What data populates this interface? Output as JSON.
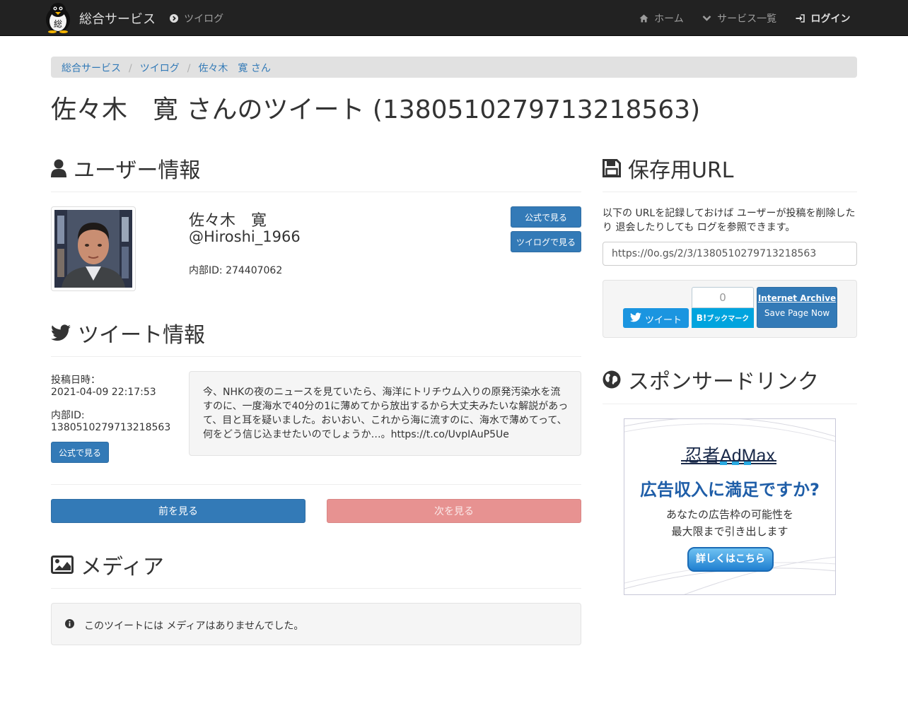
{
  "navbar": {
    "brand": "総合サービス",
    "twilog_link": "ツイログ",
    "home": "ホーム",
    "services": "サービス一覧",
    "login": "ログイン",
    "logo_char": "総"
  },
  "breadcrumb": [
    "総合サービス",
    "ツイログ",
    "佐々木　寛 さん"
  ],
  "page_title": "佐々木　寛 さんのツイート (1380510279713218563)",
  "user_section": {
    "heading": "ユーザー情報",
    "name": "佐々木　寛",
    "handle": "@Hiroshi_1966",
    "internal_id": "内部ID: 274407062",
    "btn_official": "公式で見る",
    "btn_twilog": "ツイログで見る"
  },
  "tweet_section": {
    "heading": "ツイート情報",
    "posted_label": "投稿日時：",
    "posted_value": "2021-04-09 22:17:53",
    "id_label": "内部ID:",
    "id_value": "1380510279713218563",
    "btn_official": "公式で見る",
    "text": "今、NHKの夜のニュースを見ていたら、海洋にトリチウム入りの原発汚染水を流すのに、一度海水で40分の1に薄めてから放出するから大丈夫みたいな解説があって、目と耳を疑いました。おいおい、これから海に流すのに、海水で薄めてって、何をどう信じ込ませたいのでしょうか…。https://t.co/UvpIAuP5Ue"
  },
  "pager": {
    "prev": "前を見る",
    "next": "次を見る"
  },
  "media_section": {
    "heading": "メディア",
    "empty_message": "このツイートには メディアはありませんでした。"
  },
  "save_section": {
    "heading": "保存用URL",
    "description": "以下の URLを記録しておけば ユーザーが投稿を削除したり 退会したりしても ログを参照できます。",
    "url": "https://0o.gs/2/3/1380510279713218563",
    "tweet_btn": "ツイート",
    "bookmark_count": "0",
    "bookmark_btn": "ブックマーク",
    "bookmark_b": "B!",
    "ia_title": "Internet Archive",
    "ia_sub": "Save Page Now"
  },
  "sponsor_section": {
    "heading": "スポンサードリンク",
    "ad_brand": "忍者AdMax",
    "ad_headline": "広告収入に満足ですか?",
    "ad_line1": "あなたの広告枠の可能性を",
    "ad_line2": "最大限まで引き出します",
    "ad_button": "詳しくはこちら"
  },
  "colors": {
    "navbar_bg": "#222222",
    "primary": "#337ab7",
    "next_disabled": "#e79291",
    "twitter": "#1b95e0",
    "hatena": "#00a4de"
  }
}
